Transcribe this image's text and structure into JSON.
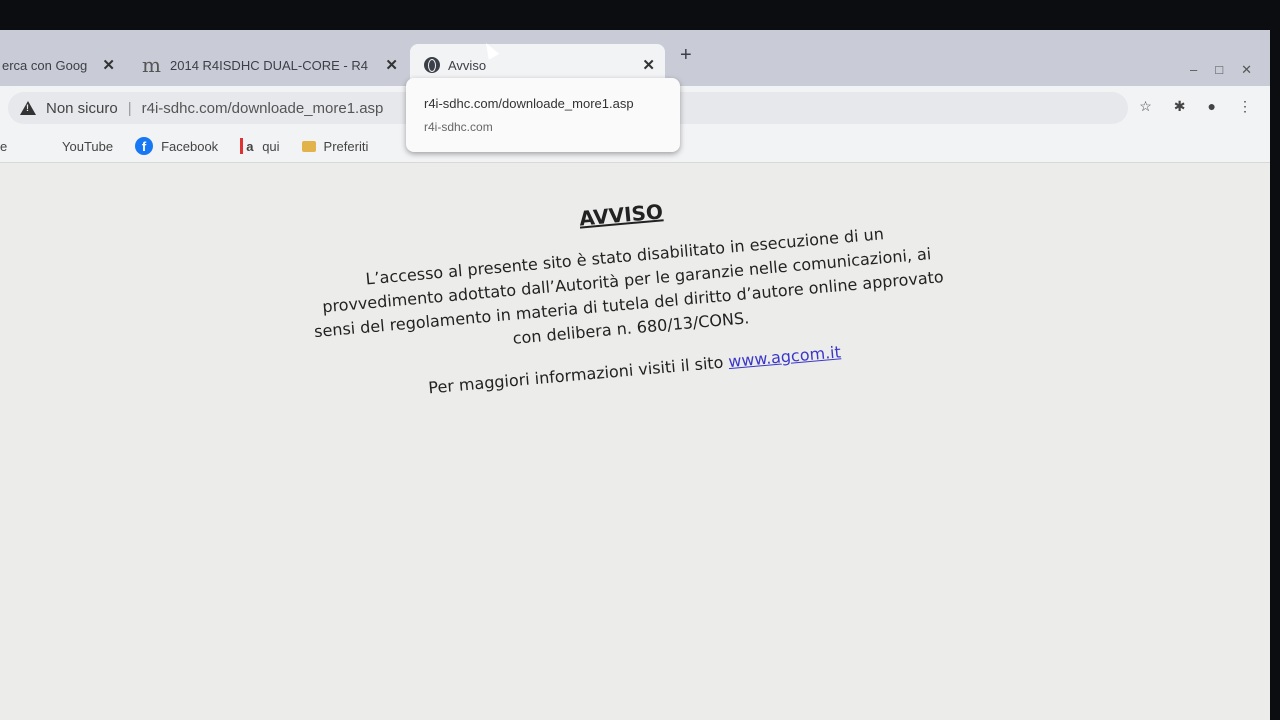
{
  "tabs": [
    {
      "title": "erca con Goog",
      "active": false
    },
    {
      "title": "2014 R4ISDHC DUAL-CORE - R4",
      "active": false
    },
    {
      "title": "Avviso",
      "active": true
    }
  ],
  "toolbar": {
    "security_label": "Non sicuro",
    "url": "r4i-sdhc.com/downloade_more1.asp"
  },
  "popup": {
    "line1": "r4i-sdhc.com/downloade_more1.asp",
    "line2": "r4i-sdhc.com"
  },
  "bookmarks": [
    {
      "label": "e"
    },
    {
      "label": "YouTube"
    },
    {
      "label": "Facebook"
    },
    {
      "label": "qui"
    },
    {
      "label": "Preferiti"
    }
  ],
  "notice": {
    "title": "AVVISO",
    "body": "L’accesso al presente sito è stato disabilitato in esecuzione di un provvedimento adottato dall’Autorità per le garanzie nelle comunicazioni, ai sensi del regolamento in materia di tutela del diritto d’autore online approvato con delibera n. 680/13/CONS.",
    "more_info": "Per maggiori informazioni visiti il sito",
    "link": "www.agcom.it"
  },
  "colors": {
    "tabstrip": "#c9ccd6",
    "toolbar": "#f2f3f5",
    "page_bg": "#ececea",
    "link": "#3b37c9"
  }
}
